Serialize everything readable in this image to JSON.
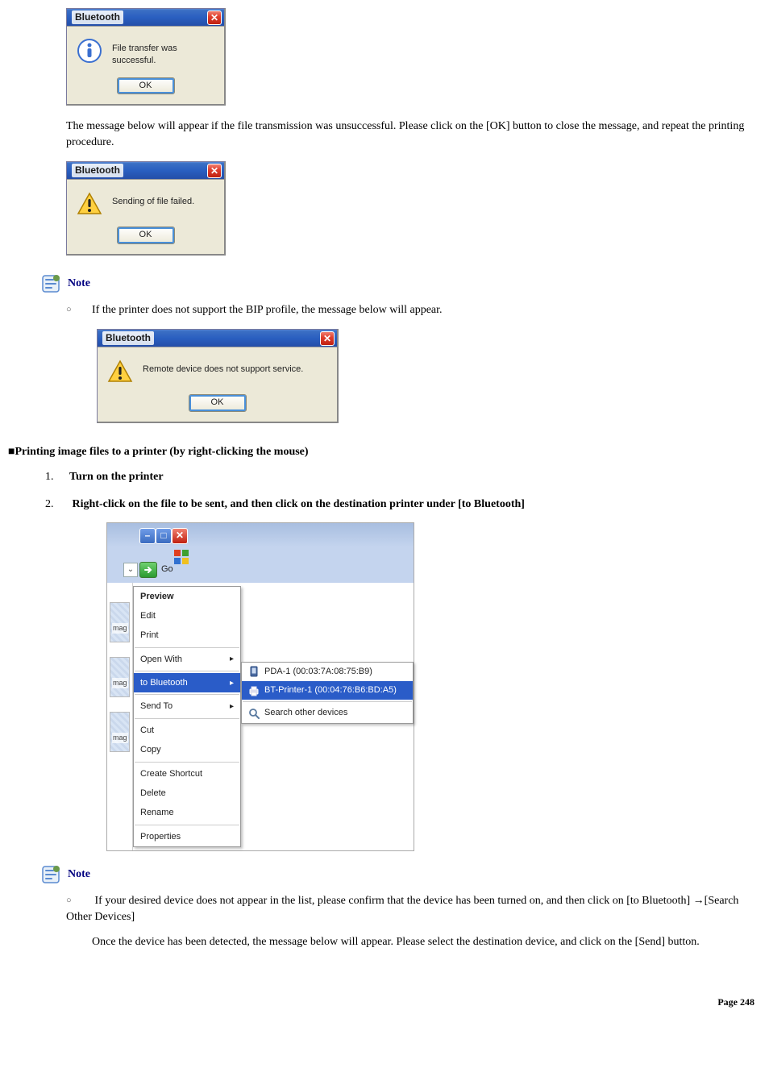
{
  "dialog_success": {
    "title": "Bluetooth",
    "message": "File transfer was successful.",
    "ok": "OK"
  },
  "para_fail": "The message below will appear if the file transmission was unsuccessful. Please click on the [OK] button to close the message, and repeat the printing procedure.",
  "dialog_fail": {
    "title": "Bluetooth",
    "message": "Sending of file failed.",
    "ok": "OK"
  },
  "note_label": "Note",
  "note_bip": "If the printer does not support the BIP profile, the message below will appear.",
  "dialog_nosupport": {
    "title": "Bluetooth",
    "message": "Remote device does not support service.",
    "ok": "OK"
  },
  "section_heading": "Printing image files to a printer (by right-clicking the mouse)",
  "steps": {
    "s1": "Turn on the printer",
    "s2": "Right-click on the file to be sent, and then click on the destination printer under [to Bluetooth]"
  },
  "ctx": {
    "go": "Go",
    "thumb": "mag",
    "menu": {
      "preview": "Preview",
      "edit": "Edit",
      "print": "Print",
      "open_with": "Open With",
      "to_bluetooth": "to Bluetooth",
      "send_to": "Send To",
      "cut": "Cut",
      "copy": "Copy",
      "create_shortcut": "Create Shortcut",
      "delete": "Delete",
      "rename": "Rename",
      "properties": "Properties"
    },
    "submenu": {
      "pda": "PDA-1 (00:03:7A:08:75:B9)",
      "printer": "BT-Printer-1 (00:04:76:B6:BD:A5)",
      "search": "Search other devices"
    }
  },
  "note_search_1": "If your desired device does not appear in the list, please confirm that the device has been turned on, and then click on [to Bluetooth] →[Search Other Devices]",
  "note_search_2": "Once the device has been detected, the message below will appear. Please select the destination device, and click on the [Send] button.",
  "page_footer": "Page 248"
}
